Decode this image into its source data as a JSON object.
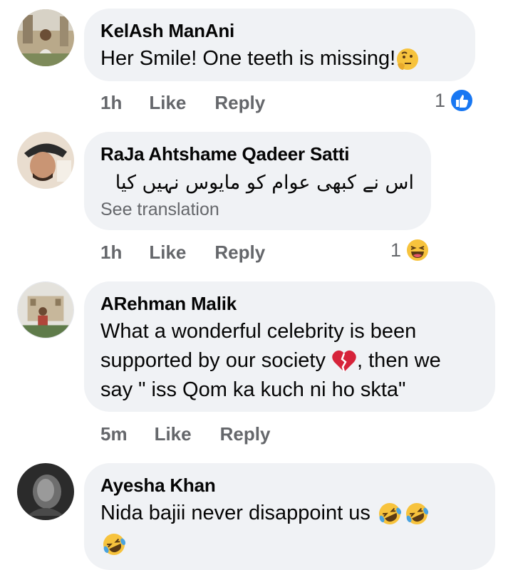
{
  "comments": [
    {
      "author": "KelAsh ManAni",
      "text": "Her Smile! One teeth is missing!",
      "time": "1h",
      "like": "Like",
      "reply": "Reply",
      "reaction_count": "1",
      "reaction_icon": "like-icon"
    },
    {
      "author": "RaJa Ahtshame Qadeer Satti",
      "text": "اس نے کبھی عوام کو مایوس نہیں کیا",
      "see_translation": "See translation",
      "time": "1h",
      "like": "Like",
      "reply": "Reply",
      "reaction_count": "1",
      "reaction_icon": "haha-icon"
    },
    {
      "author": "ARehman Malik",
      "text_line1": "What a wonderful celebrity is been",
      "text_line2a": "supported by our society ",
      "text_line2b": ", then we",
      "text_line3": "say \" iss Qom ka kuch ni ho skta\"",
      "time": "5m",
      "like": "Like",
      "reply": "Reply"
    },
    {
      "author": "Ayesha Khan",
      "text": "Nida bajii never disappoint us "
    }
  ],
  "colors": {
    "bubble": "#f0f2f5",
    "meta": "#65676b",
    "like_blue": "#1877f2"
  }
}
